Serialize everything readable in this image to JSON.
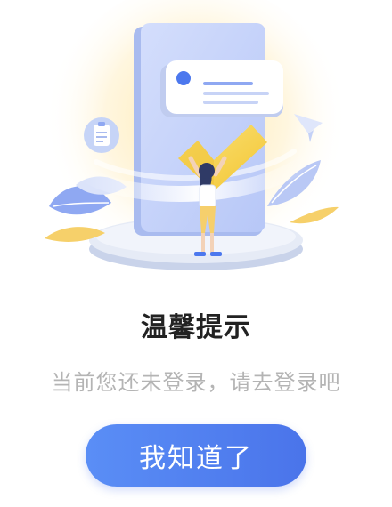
{
  "dialog": {
    "title": "温馨提示",
    "message": "当前您还未登录，请去登录吧",
    "confirm_label": "我知道了"
  },
  "illustration": {
    "icon": "login-required-illustration",
    "colors": {
      "glow": "#ffe7a8",
      "phone": "#c9d6fb",
      "check": "#f7d54a",
      "card_dot": "#4c78ee"
    }
  },
  "theme": {
    "button_gradient_start": "#5a8ef6",
    "button_gradient_end": "#4a74ea",
    "title_color": "#222222",
    "message_color": "#b4b4b4"
  }
}
